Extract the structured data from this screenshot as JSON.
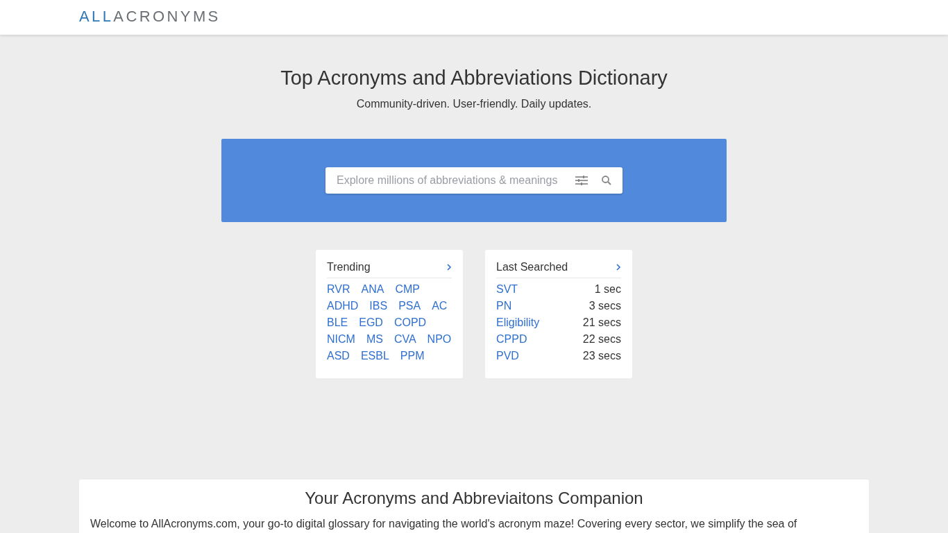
{
  "logo": {
    "part_1": "ALL",
    "part_2": "ACRONYMS"
  },
  "hero": {
    "title": "Top Acronyms and Abbreviations Dictionary",
    "subtitle": "Community-driven. User-friendly. Daily updates."
  },
  "search": {
    "placeholder": "Explore millions of abbreviations & meanings"
  },
  "trending": {
    "title": "Trending",
    "rows": [
      [
        "RVR",
        "ANA",
        "CMP"
      ],
      [
        "ADHD",
        "IBS",
        "PSA",
        "AC"
      ],
      [
        "BLE",
        "EGD",
        "COPD"
      ],
      [
        "NICM",
        "MS",
        "CVA",
        "NPO"
      ],
      [
        "ASD",
        "ESBL",
        "PPM"
      ]
    ]
  },
  "last_searched": {
    "title": "Last Searched",
    "items": [
      {
        "term": "SVT",
        "time": "1 sec"
      },
      {
        "term": "PN",
        "time": "3 secs"
      },
      {
        "term": "Eligibility",
        "time": "21 secs"
      },
      {
        "term": "CPPD",
        "time": "22 secs"
      },
      {
        "term": "PVD",
        "time": "23 secs"
      }
    ]
  },
  "about": {
    "title": "Your Acronyms and Abbreviaitons Companion",
    "text": "Welcome to AllAcronyms.com, your go-to digital glossary for navigating the world's acronym maze! Covering every sector, we simplify the sea of"
  }
}
